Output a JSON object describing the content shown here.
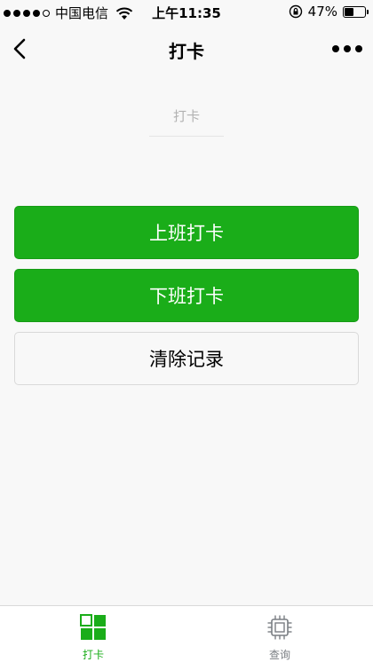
{
  "status_bar": {
    "carrier": "中国电信",
    "time": "上午11:35",
    "battery": "47%",
    "battery_level": 0.47
  },
  "nav": {
    "title": "打卡"
  },
  "content": {
    "punch_label": "打卡",
    "buttons": {
      "clock_in": "上班打卡",
      "clock_out": "下班打卡",
      "clear": "清除记录"
    }
  },
  "tabs": [
    {
      "label": "打卡",
      "icon": "grid-icon",
      "active": true
    },
    {
      "label": "查询",
      "icon": "chip-icon",
      "active": false
    }
  ],
  "colors": {
    "primary": "#1aad19",
    "inactive_tab": "#7a7e83",
    "placeholder": "#b2b2b2"
  }
}
